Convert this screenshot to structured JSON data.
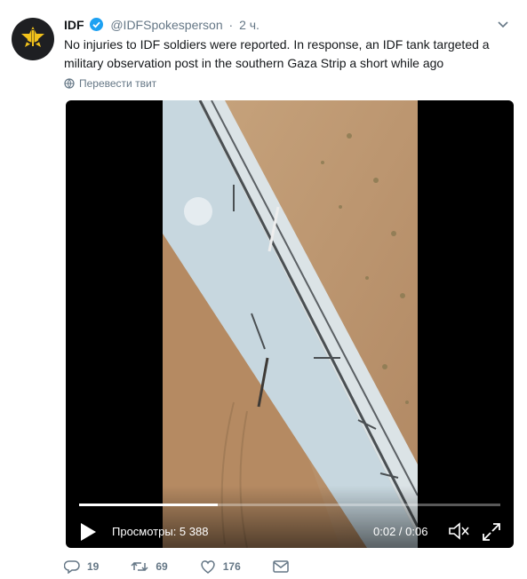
{
  "tweet": {
    "display_name": "IDF",
    "handle": "@IDFSpokesperson",
    "separator": "·",
    "time": "2 ч.",
    "text": "No injuries to IDF soldiers were reported. In response, an IDF tank targeted a military observation post in the southern Gaza Strip a short while ago",
    "translate_label": "Перевести твит"
  },
  "video": {
    "views_label": "Просмотры: 5 388",
    "timecode": "0:02 / 0:06",
    "progress": 0.33
  },
  "actions": {
    "replies": "19",
    "retweets": "69",
    "likes": "176"
  },
  "colors": {
    "verified": "#1da1f2",
    "avatar_bg": "#1e1f22",
    "avatar_emblem": "#f2c21b",
    "secondary_text": "#657786"
  }
}
